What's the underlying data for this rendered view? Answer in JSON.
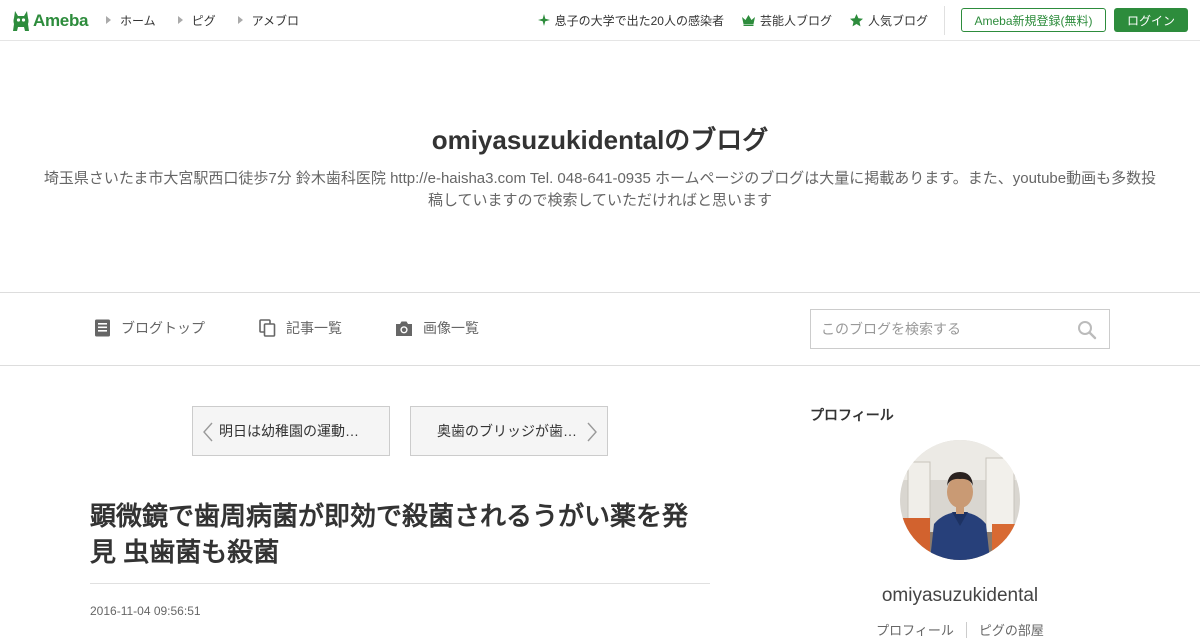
{
  "global_header": {
    "logo_text": "Ameba",
    "nav": [
      "ホーム",
      "ピグ",
      "アメブロ"
    ],
    "links": [
      {
        "icon": "sparkle-icon",
        "label": "息子の大学で出た20人の感染者"
      },
      {
        "icon": "crown-icon",
        "label": "芸能人ブログ"
      },
      {
        "icon": "star-icon",
        "label": "人気ブログ"
      }
    ],
    "register_label": "Ameba新規登録(無料)",
    "login_label": "ログイン",
    "accent_color": "#2d8c3c"
  },
  "blog": {
    "title": "omiyasuzukidentalのブログ",
    "description": "埼玉県さいたま市大宮駅西口徒歩7分 鈴木歯科医院 http://e-haisha3.com Tel. 048-641-0935 ホームページのブログは大量に掲載あります。また、youtube動画も多数投稿していますので検索していただければと思います"
  },
  "blog_nav": {
    "items": [
      {
        "icon": "document-icon",
        "label": "ブログトップ"
      },
      {
        "icon": "copy-icon",
        "label": "記事一覧"
      },
      {
        "icon": "camera-icon",
        "label": "画像一覧"
      }
    ],
    "search_placeholder": "このブログを検索する"
  },
  "pager": {
    "prev": "明日は幼稚園の運動会です",
    "next": "奥歯のブリッジが歯茎にくい込む"
  },
  "article": {
    "title": "顕微鏡で歯周病菌が即効で殺菌されるうがい薬を発見 虫歯菌も殺菌",
    "date": "2016-11-04 09:56:51"
  },
  "sidebar": {
    "heading": "プロフィール",
    "name": "omiyasuzukidental",
    "links": [
      "プロフィール",
      "ピグの部屋"
    ]
  }
}
